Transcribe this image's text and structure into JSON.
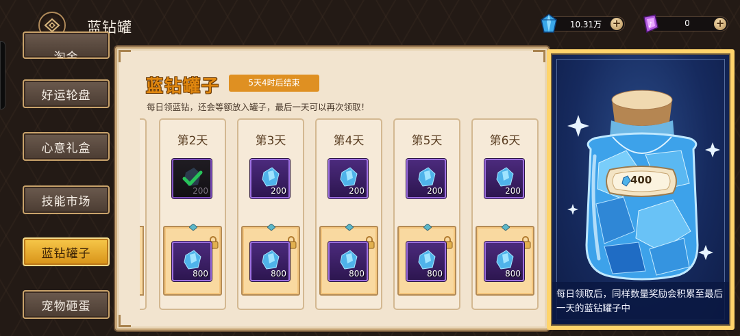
{
  "header": {
    "title": "蓝钻罐",
    "currencies": [
      {
        "icon": "blue-diamond-icon",
        "amount": "10.31万",
        "plus": "+"
      },
      {
        "icon": "purple-gem-icon",
        "amount": "0",
        "plus": "+"
      }
    ]
  },
  "sidebar": {
    "items": [
      {
        "label": "淘金",
        "active": false
      },
      {
        "label": "好运轮盘",
        "active": false
      },
      {
        "label": "心意礼盒",
        "active": false
      },
      {
        "label": "技能市场",
        "active": false
      },
      {
        "label": "蓝钻罐子",
        "active": true
      },
      {
        "label": "宠物砸蛋",
        "active": false
      }
    ]
  },
  "main": {
    "title": "蓝钻罐子",
    "timer": "5天4时后结束",
    "description": "每日领蓝钻，还会等额放入罐子，最后一天可以再次领取！",
    "days": [
      {
        "label": "第2天",
        "daily": "200",
        "daily_claimed": true,
        "bonus": "800",
        "locked": true
      },
      {
        "label": "第3天",
        "daily": "200",
        "daily_claimed": false,
        "bonus": "800",
        "locked": true
      },
      {
        "label": "第4天",
        "daily": "200",
        "daily_claimed": false,
        "bonus": "800",
        "locked": true
      },
      {
        "label": "第5天",
        "daily": "200",
        "daily_claimed": false,
        "bonus": "800",
        "locked": true
      },
      {
        "label": "第6天",
        "daily": "200",
        "daily_claimed": false,
        "bonus": "800",
        "locked": true
      }
    ]
  },
  "jar": {
    "count": "400",
    "description": "每日领取后，同样数量奖励会积累至最后一天的蓝钻罐子中"
  },
  "colors": {
    "accent_orange": "#df9022",
    "title_orange": "#e0870f",
    "active_gold": "#f0b535",
    "panel_bg": "#f2e4cf",
    "card_border": "#d3b891"
  }
}
